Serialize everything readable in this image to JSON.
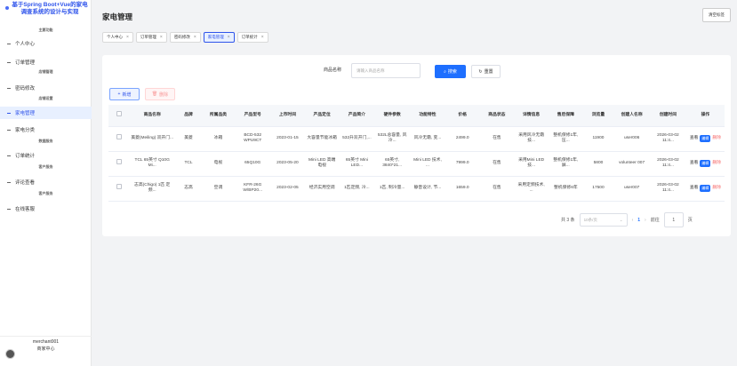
{
  "sidebar": {
    "brand_title": "基于Spring Boot+Vue的家电调查系统的设计与实现",
    "brand_sub": "主要功能",
    "items": [
      {
        "label": "个人中心",
        "sub": ""
      },
      {
        "label": "订单管理",
        "sub": "店铺管理"
      },
      {
        "label": "密码修改",
        "sub": "店铺设置"
      },
      {
        "label": "家电管理",
        "sub": ""
      },
      {
        "label": "家电分类",
        "sub": "数据服务"
      },
      {
        "label": "订单统计",
        "sub": "客户服务"
      },
      {
        "label": "评论查看",
        "sub": "客户服务"
      },
      {
        "label": "在线客服",
        "sub": ""
      }
    ],
    "user_name": "merchant001",
    "user_role": "商家中心"
  },
  "header": {
    "title": "家电管理",
    "clear_label": "清空标签"
  },
  "tabs": [
    {
      "label": "个人中心"
    },
    {
      "label": "订单管理"
    },
    {
      "label": "密码修改"
    },
    {
      "label": "家电管理"
    },
    {
      "label": "订单统计"
    }
  ],
  "search": {
    "label": "商品名称",
    "placeholder": "请输入商品名称",
    "search_label": "搜索",
    "reset_label": "重置"
  },
  "actions": {
    "add_label": "新增",
    "delete_label": "删除"
  },
  "table": {
    "columns": [
      "商品名称",
      "品牌",
      "所属品类",
      "产品型号",
      "上市时间",
      "产品定位",
      "产品简介",
      "硬件参数",
      "功能特性",
      "价格",
      "商品状态",
      "详情信息",
      "售后保障",
      "浏览量",
      "创建人名称",
      "创建时间",
      "操作"
    ],
    "rows": [
      [
        "美菱(Meiling) 双开门...",
        "美菱",
        "冰箱",
        "BCD-532 WPU9CT",
        "2023-01-15",
        "大容量节能冰箱",
        "532升双开门,...",
        "532L总容量, 风冷...",
        "风冷无霜, 变...",
        "2499.0",
        "在售",
        "采用风冷无霜技...",
        "整机保修1年, 压...",
        "11900",
        "user006",
        "2026-03-02 11:4..."
      ],
      [
        "TCL 65英寸 Q10G Mi...",
        "TCL",
        "电视",
        "65Q10G",
        "2023-05-20",
        "Mini LED 高端电视",
        "65英寸 Mini LED...",
        "65英寸, 3840*21...",
        "Mini LED 技术, ...",
        "7999.0",
        "在售",
        "采用Mini LED技...",
        "整机保修1年, 屏...",
        "5800",
        "volunteer 007",
        "2026-03-02 11:4..."
      ],
      [
        "志高(Chigo) 1匹 定频...",
        "志高",
        "空调",
        "KFR-26G W/BP20...",
        "2023-02-05",
        "经济实用空调",
        "1匹定频, 冷...",
        "1匹, 制冷量...",
        "静音设计, 节...",
        "1659.0",
        "在售",
        "采用定频技术, ...",
        "整机保修6年",
        "17500",
        "user007",
        "2026-03-02 11:4..."
      ]
    ],
    "op_view": "查看",
    "op_edit": "编辑",
    "op_delete": "删除"
  },
  "pager": {
    "total": "共 3 条",
    "page_size": "10条/页",
    "current": "1",
    "goto_label": "前往",
    "goto_value": "1",
    "page_unit": "页"
  },
  "colors": {
    "primary": "#1e6fff",
    "danger": "#f56c6c",
    "accent": "#2f54eb"
  }
}
